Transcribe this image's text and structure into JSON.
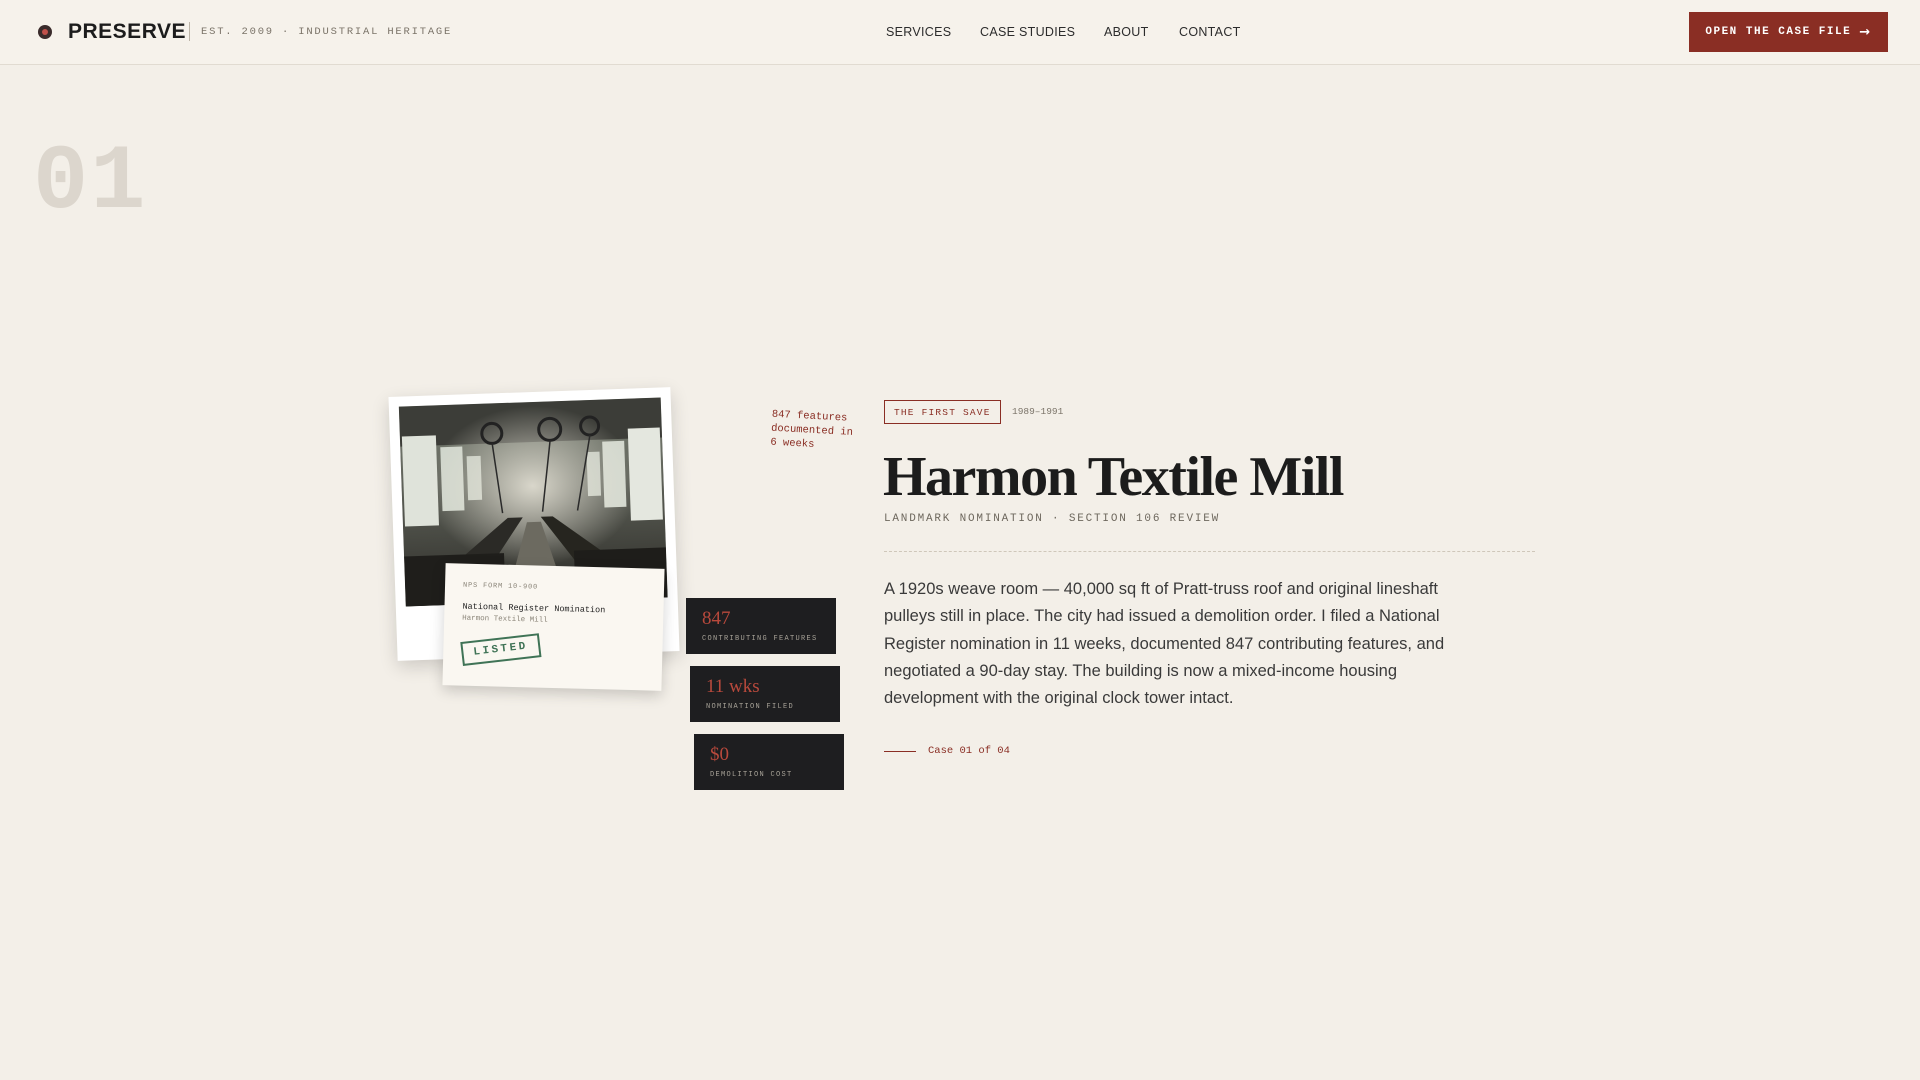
{
  "header": {
    "brand": "PRESERVE",
    "tagline": "EST. 2009 · INDUSTRIAL HERITAGE",
    "nav": [
      "SERVICES",
      "CASE STUDIES",
      "ABOUT",
      "CONTACT"
    ],
    "cta_label": "OPEN THE CASE FILE",
    "cta_icon": "arrow-right-icon"
  },
  "case_index": "01",
  "artifact": {
    "photo_icon": "mill-weave-room-photo",
    "doc_form": "NPS FORM 10-900",
    "doc_title": "National Register Nomination",
    "doc_subtitle": "Harmon Textile Mill",
    "stamp": "LISTED",
    "margin_note": "847 features documented in 6 weeks"
  },
  "stats": [
    {
      "value": "847",
      "label": "CONTRIBUTING FEATURES"
    },
    {
      "value": "11 wks",
      "label": "NOMINATION FILED"
    },
    {
      "value": "$0",
      "label": "DEMOLITION COST"
    }
  ],
  "case": {
    "badge": "THE FIRST SAVE",
    "years": "1989–1991",
    "title": "Harmon Textile Mill",
    "subtitle": "LANDMARK NOMINATION · SECTION 106 REVIEW",
    "body": "A 1920s weave room — 40,000 sq ft of Pratt-truss roof and original lineshaft pulleys still in place. The city had issued a demolition order. I filed a National Register nomination in 11 weeks, documented 847 contributing features, and negotiated a 90-day stay. The building is now a mixed-income housing development with the original clock tower intact.",
    "counter": "Case 01 of 04"
  },
  "colors": {
    "accent": "#8a2e24",
    "background": "#f3efe8",
    "stamp_green": "#3f7356",
    "stat_bg": "#1e1e20"
  }
}
